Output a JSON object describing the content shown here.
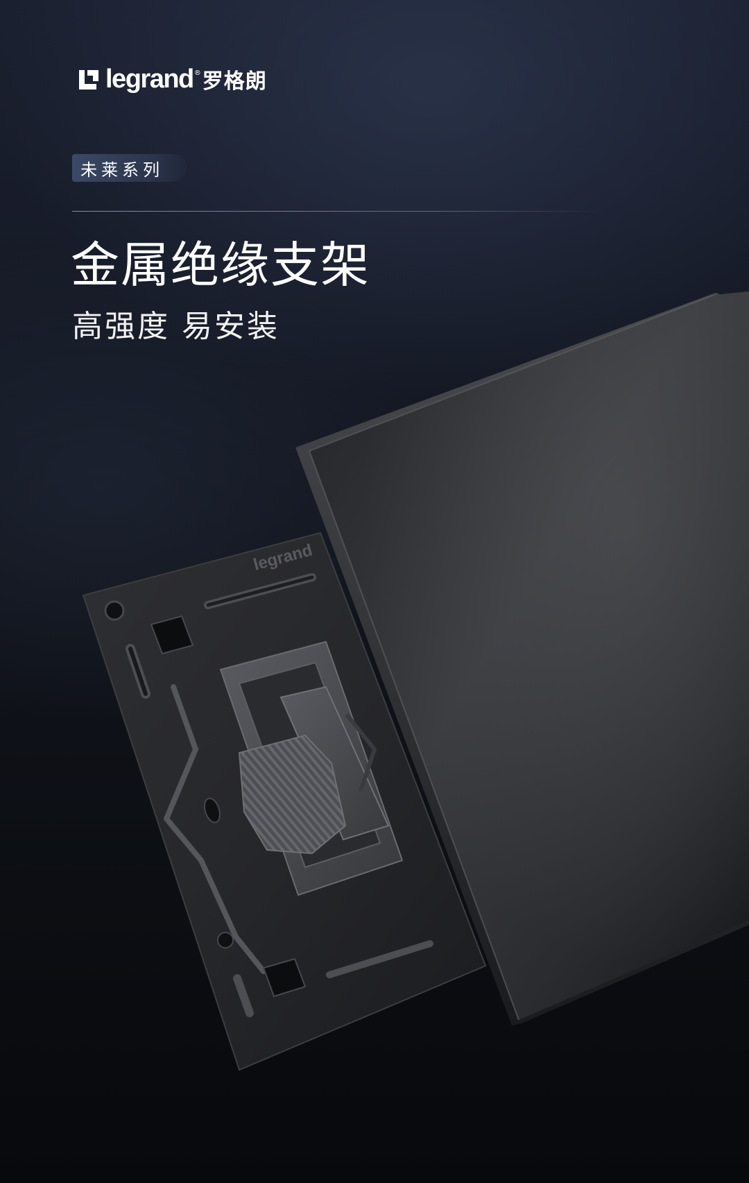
{
  "brand": {
    "logo_word": "legrand",
    "logo_reg": "®",
    "logo_cn": "罗格朗"
  },
  "series_tag": "未莱系列",
  "headline": "金属绝缘支架",
  "subline": "高强度 易安装",
  "product": {
    "bracket_emboss": "legrand"
  },
  "colors": {
    "background_top": "#1b2030",
    "background_bottom": "#08090c",
    "panel": "#2b2c2f",
    "bracket": "#2a2b2e",
    "mechanism": "#4a4b4f",
    "text": "#ffffff"
  }
}
